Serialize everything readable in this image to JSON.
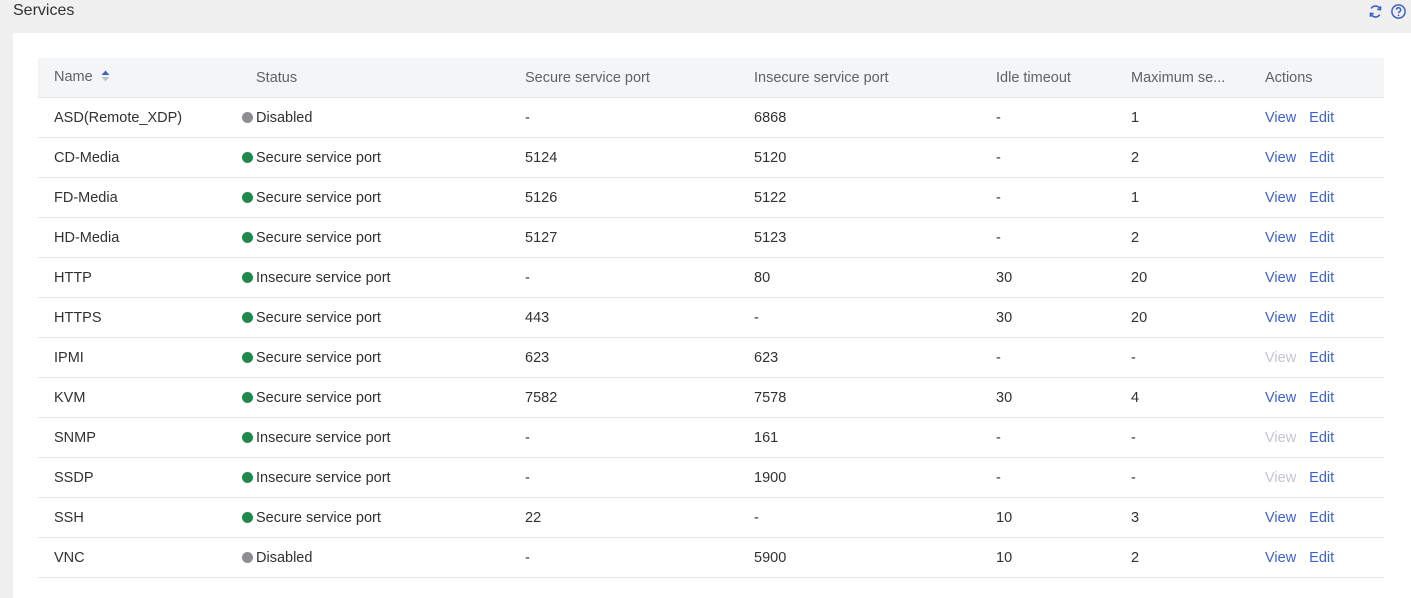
{
  "header": {
    "title": "Services",
    "icons": [
      "refresh-icon",
      "help-icon"
    ]
  },
  "colors": {
    "enabled_dot": "#1f8a4c",
    "disabled_dot": "#8e8e93",
    "link": "#3d63c9",
    "link_disabled": "#c3c6cc"
  },
  "table": {
    "columns": {
      "name": "Name",
      "status": "Status",
      "secure_port": "Secure service port",
      "insecure_port": "Insecure service port",
      "idle_timeout": "Idle timeout",
      "max_sessions": "Maximum se...",
      "actions": "Actions"
    },
    "view_label": "View",
    "edit_label": "Edit",
    "rows": [
      {
        "name": "ASD(Remote_XDP)",
        "status": "Disabled",
        "enabled": false,
        "secure_port": "-",
        "insecure_port": "6868",
        "idle_timeout": "-",
        "max_sessions": "1",
        "view_enabled": true
      },
      {
        "name": "CD-Media",
        "status": "Secure service port",
        "enabled": true,
        "secure_port": "5124",
        "insecure_port": "5120",
        "idle_timeout": "-",
        "max_sessions": "2",
        "view_enabled": true
      },
      {
        "name": "FD-Media",
        "status": "Secure service port",
        "enabled": true,
        "secure_port": "5126",
        "insecure_port": "5122",
        "idle_timeout": "-",
        "max_sessions": "1",
        "view_enabled": true
      },
      {
        "name": "HD-Media",
        "status": "Secure service port",
        "enabled": true,
        "secure_port": "5127",
        "insecure_port": "5123",
        "idle_timeout": "-",
        "max_sessions": "2",
        "view_enabled": true
      },
      {
        "name": "HTTP",
        "status": "Insecure service port",
        "enabled": true,
        "secure_port": "-",
        "insecure_port": "80",
        "idle_timeout": "30",
        "max_sessions": "20",
        "view_enabled": true
      },
      {
        "name": "HTTPS",
        "status": "Secure service port",
        "enabled": true,
        "secure_port": "443",
        "insecure_port": "-",
        "idle_timeout": "30",
        "max_sessions": "20",
        "view_enabled": true
      },
      {
        "name": "IPMI",
        "status": "Secure service port",
        "enabled": true,
        "secure_port": "623",
        "insecure_port": "623",
        "idle_timeout": "-",
        "max_sessions": "-",
        "view_enabled": false
      },
      {
        "name": "KVM",
        "status": "Secure service port",
        "enabled": true,
        "secure_port": "7582",
        "insecure_port": "7578",
        "idle_timeout": "30",
        "max_sessions": "4",
        "view_enabled": true
      },
      {
        "name": "SNMP",
        "status": "Insecure service port",
        "enabled": true,
        "secure_port": "-",
        "insecure_port": "161",
        "idle_timeout": "-",
        "max_sessions": "-",
        "view_enabled": false
      },
      {
        "name": "SSDP",
        "status": "Insecure service port",
        "enabled": true,
        "secure_port": "-",
        "insecure_port": "1900",
        "idle_timeout": "-",
        "max_sessions": "-",
        "view_enabled": false
      },
      {
        "name": "SSH",
        "status": "Secure service port",
        "enabled": true,
        "secure_port": "22",
        "insecure_port": "-",
        "idle_timeout": "10",
        "max_sessions": "3",
        "view_enabled": true
      },
      {
        "name": "VNC",
        "status": "Disabled",
        "enabled": false,
        "secure_port": "-",
        "insecure_port": "5900",
        "idle_timeout": "10",
        "max_sessions": "2",
        "view_enabled": true
      }
    ]
  }
}
